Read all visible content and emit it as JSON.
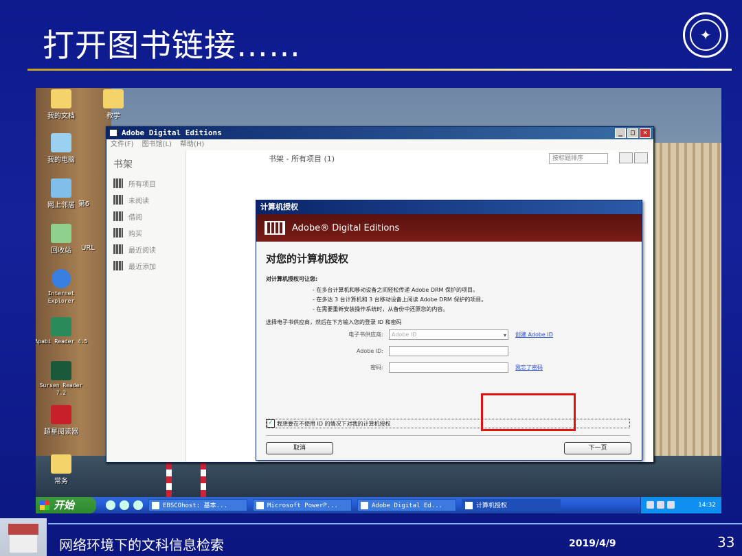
{
  "slide": {
    "title": "打开图书链接……",
    "footer_text": "网络环境下的文科信息检索",
    "date": "2019/4/9",
    "page_number": "33"
  },
  "desktop_icons": [
    {
      "label": "我的文档"
    },
    {
      "label": "教学"
    },
    {
      "label": "我的电脑"
    },
    {
      "label": "网上邻居"
    },
    {
      "label": "第6"
    },
    {
      "label": "回收站"
    },
    {
      "label": "URL"
    },
    {
      "label": "Internet Explorer"
    },
    {
      "label": "Apabi Reader 4.5"
    },
    {
      "label": "Sursen Reader 7.2"
    },
    {
      "label": "超星阅读器"
    },
    {
      "label": "常务"
    }
  ],
  "ade": {
    "title": "Adobe Digital Editions",
    "menu": [
      "文件(F)",
      "图书馆(L)",
      "帮助(H)"
    ],
    "shelf_heading": "书架",
    "shelf_items": [
      "所有项目",
      "未阅读",
      "借阅",
      "购买",
      "最近阅读",
      "最近添加"
    ],
    "main_heading": "书架 - 所有项目 (1)",
    "sort_label": "按标题排序"
  },
  "dialog": {
    "title": "计算机授权",
    "banner": "Adobe® Digital Editions",
    "heading": "对您的计算机授权",
    "intro": "对计算机授权可让您:",
    "perms": [
      "- 在多台计算机和移动设备之间轻松传递 Adobe DRM 保护的项目。",
      "- 在多达 3 台计算机和 3 台移动设备上阅读 Adobe DRM 保护的项目。",
      "- 在需要重新安装操作系统时，从备份中还原您的内容。"
    ],
    "select_prompt": "选择电子书供应商，然后在下方输入您的登录 ID 和密码",
    "vendor_label": "电子书供应商:",
    "vendor_value": "Adobe ID",
    "create_link": "创建 Adobe ID",
    "id_label": "Adobe ID:",
    "password_label": "密码:",
    "forgot_link": "我忘了密码",
    "checkbox_label": "我想要在不使用 ID 的情况下对我的计算机授权",
    "cancel": "取消",
    "next": "下一页"
  },
  "taskbar": {
    "start": "开始",
    "tasks": [
      "EBSCOhost: 基本...",
      "Microsoft PowerP...",
      "Adobe Digital Ed...",
      "计算机授权"
    ],
    "clock": "14:32"
  }
}
